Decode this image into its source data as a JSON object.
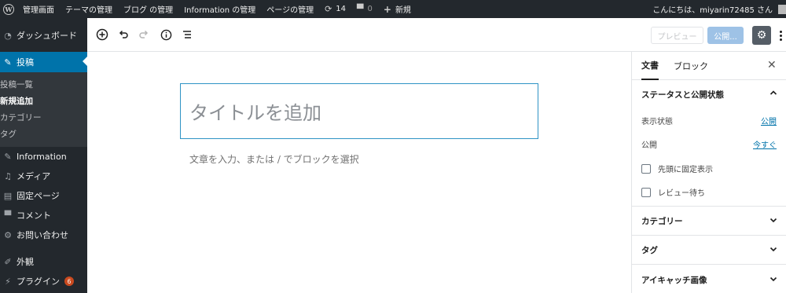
{
  "adminbar": {
    "wp_logo_icon": "wordpress-logo-icon",
    "site_name": "管理画面",
    "theme_admin": "テーマの管理",
    "blog_admin": "ブログ の管理",
    "info_admin": "Information の管理",
    "page_admin": "ページの管理",
    "updates_count": "14",
    "comments_count": "0",
    "new_label": "新規",
    "greeting": "こんにちは、miyarin72485 さん"
  },
  "sidebar": {
    "dashboard": "ダッシュボード",
    "posts": "投稿",
    "posts_submenu": {
      "all": "投稿一覧",
      "add_new": "新規追加",
      "categories": "カテゴリー",
      "tags": "タグ"
    },
    "information": "Information",
    "media": "メディア",
    "pages": "固定ページ",
    "comments": "コメント",
    "contact": "お問い合わせ",
    "appearance": "外観",
    "plugins": "プラグイン",
    "plugins_badge": "6"
  },
  "toolbar": {
    "preview_label": "プレビュー",
    "publish_label": "公開..."
  },
  "editor": {
    "title_placeholder": "タイトルを追加",
    "paragraph_placeholder": "文章を入力、または / でブロックを選択"
  },
  "panel": {
    "tab_document": "文書",
    "tab_block": "ブロック",
    "status_section": "ステータスと公開状態",
    "visibility_label": "表示状態",
    "visibility_value": "公開",
    "publish_label": "公開",
    "publish_value": "今すぐ",
    "sticky_label": "先頭に固定表示",
    "pending_label": "レビュー待ち",
    "categories_section": "カテゴリー",
    "tags_section": "タグ",
    "featured_image_section": "アイキャッチ画像"
  }
}
